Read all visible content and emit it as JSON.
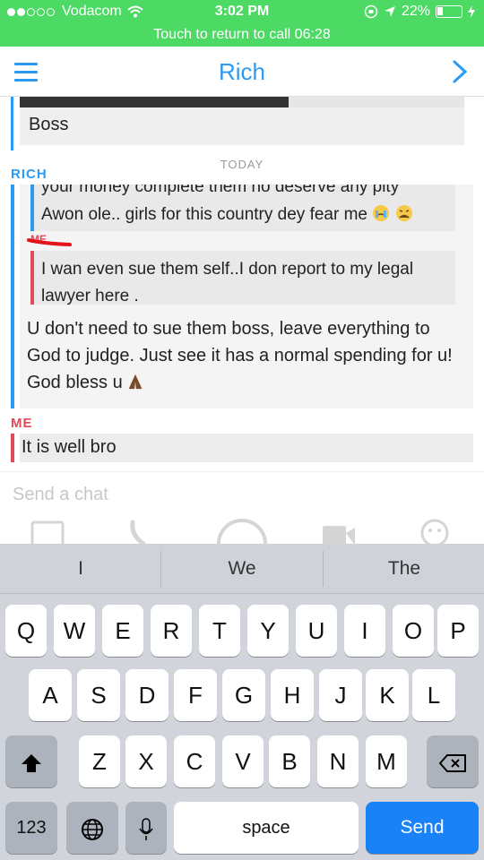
{
  "status_bar": {
    "carrier": "Vodacom",
    "time": "3:02 PM",
    "battery": "22%"
  },
  "call_banner": "Touch to return to call 06:28",
  "header": {
    "title": "Rich"
  },
  "chat": {
    "previous_caption": "Boss",
    "date_divider": "TODAY",
    "rich_label": "RICH",
    "quote_top_partial": "your money complete them no deserve any pity",
    "quote_top_line": "Awon ole.. girls for this country dey fear me",
    "quote_me_label": "ME",
    "quote_me_text": "I wan even sue them self..I don report to my legal lawyer here .",
    "reply_text": "U don't need to sue them boss, leave everything to God to judge. Just see it has a normal spending for u! God bless u",
    "me_label": "ME",
    "me_message": "It is well bro"
  },
  "composer": {
    "placeholder": "Send a chat"
  },
  "keyboard": {
    "suggestions": [
      "I",
      "We",
      "The"
    ],
    "row1": [
      "Q",
      "W",
      "E",
      "R",
      "T",
      "Y",
      "U",
      "I",
      "O",
      "P"
    ],
    "row2": [
      "A",
      "S",
      "D",
      "F",
      "G",
      "H",
      "J",
      "K",
      "L"
    ],
    "row3": [
      "Z",
      "X",
      "C",
      "V",
      "B",
      "N",
      "M"
    ],
    "numbers_key": "123",
    "space_key": "space",
    "send_key": "Send"
  },
  "colors": {
    "status_green": "#4cd964",
    "accent_blue": "#2b9af3",
    "me_red": "#e04b5a",
    "send_blue": "#1a82f7"
  }
}
